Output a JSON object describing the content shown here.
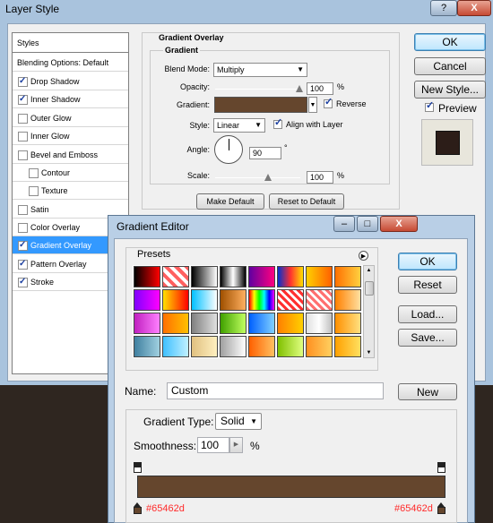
{
  "layer_style": {
    "title": "Layer Style",
    "help": "?",
    "close": "X",
    "styles_header": "Styles",
    "blending_options": "Blending Options: Default",
    "items": [
      {
        "label": "Drop Shadow",
        "checked": true
      },
      {
        "label": "Inner Shadow",
        "checked": true
      },
      {
        "label": "Outer Glow",
        "checked": false
      },
      {
        "label": "Inner Glow",
        "checked": false
      },
      {
        "label": "Bevel and Emboss",
        "checked": false
      },
      {
        "label": "Contour",
        "checked": false
      },
      {
        "label": "Texture",
        "checked": false
      },
      {
        "label": "Satin",
        "checked": false
      },
      {
        "label": "Color Overlay",
        "checked": false
      },
      {
        "label": "Gradient Overlay",
        "checked": true
      },
      {
        "label": "Pattern Overlay",
        "checked": true
      },
      {
        "label": "Stroke",
        "checked": true
      }
    ],
    "section_title": "Gradient Overlay",
    "group_title": "Gradient",
    "blend_mode_label": "Blend Mode:",
    "blend_mode": "Multiply",
    "opacity_label": "Opacity:",
    "opacity": "100",
    "opacity_unit": "%",
    "gradient_label": "Gradient:",
    "reverse_label": "Reverse",
    "style_label": "Style:",
    "style": "Linear",
    "align_label": "Align with Layer",
    "angle_label": "Angle:",
    "angle": "90",
    "angle_unit": "°",
    "scale_label": "Scale:",
    "scale": "100",
    "scale_unit": "%",
    "make_default": "Make Default",
    "reset_default": "Reset to Default",
    "ok": "OK",
    "cancel": "Cancel",
    "new_style": "New Style...",
    "preview": "Preview",
    "gradient_color": "#65462d"
  },
  "gradient_editor": {
    "title": "Gradient Editor",
    "presets_label": "Presets",
    "ok": "OK",
    "reset": "Reset",
    "load": "Load...",
    "save": "Save...",
    "name_label": "Name:",
    "name_value": "Custom",
    "new_button": "New",
    "gradient_type_label": "Gradient Type:",
    "gradient_type": "Solid",
    "smoothness_label": "Smoothness:",
    "smoothness": "100",
    "smoothness_unit": "%",
    "stop_left": "#65462d",
    "stop_right": "#65462d",
    "bar_color": "#65462d"
  }
}
